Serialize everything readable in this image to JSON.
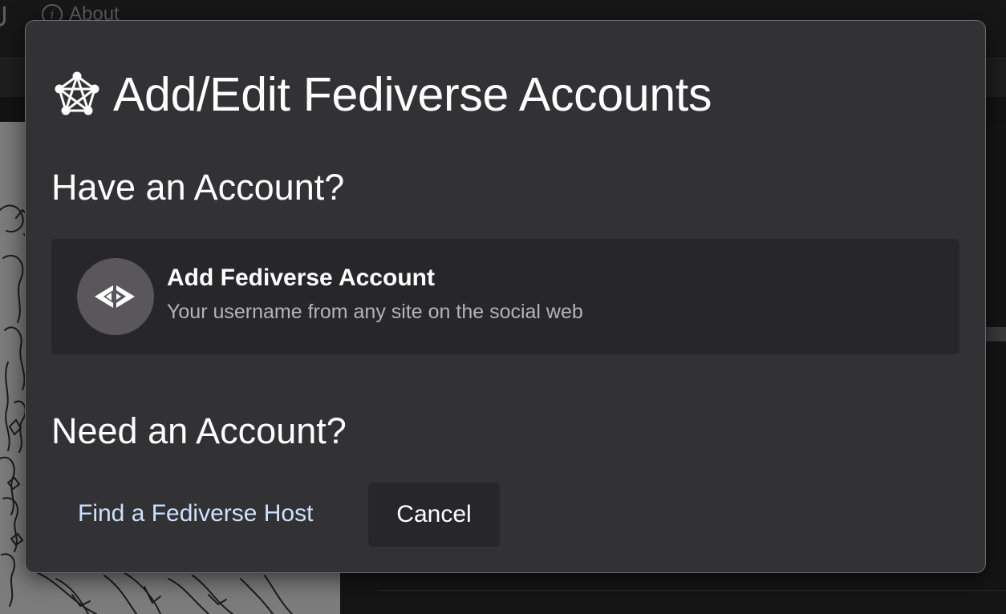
{
  "background": {
    "nav_about_label": "About"
  },
  "modal": {
    "title": "Add/Edit Fediverse Accounts",
    "title_icon": "fediverse-pentagram-icon",
    "have_account_heading": "Have an Account?",
    "add_account": {
      "icon": "activitypub-icon",
      "title": "Add Fediverse Account",
      "subtitle": "Your username from any site on the social web"
    },
    "need_account_heading": "Need an Account?",
    "find_host_link": "Find a Fediverse Host",
    "cancel_label": "Cancel"
  },
  "colors": {
    "modal_bg": "#323133",
    "card_bg": "#272628",
    "avatar_bg": "#59575a",
    "link": "#cfe0ff",
    "muted_text": "#b4b3b5"
  }
}
